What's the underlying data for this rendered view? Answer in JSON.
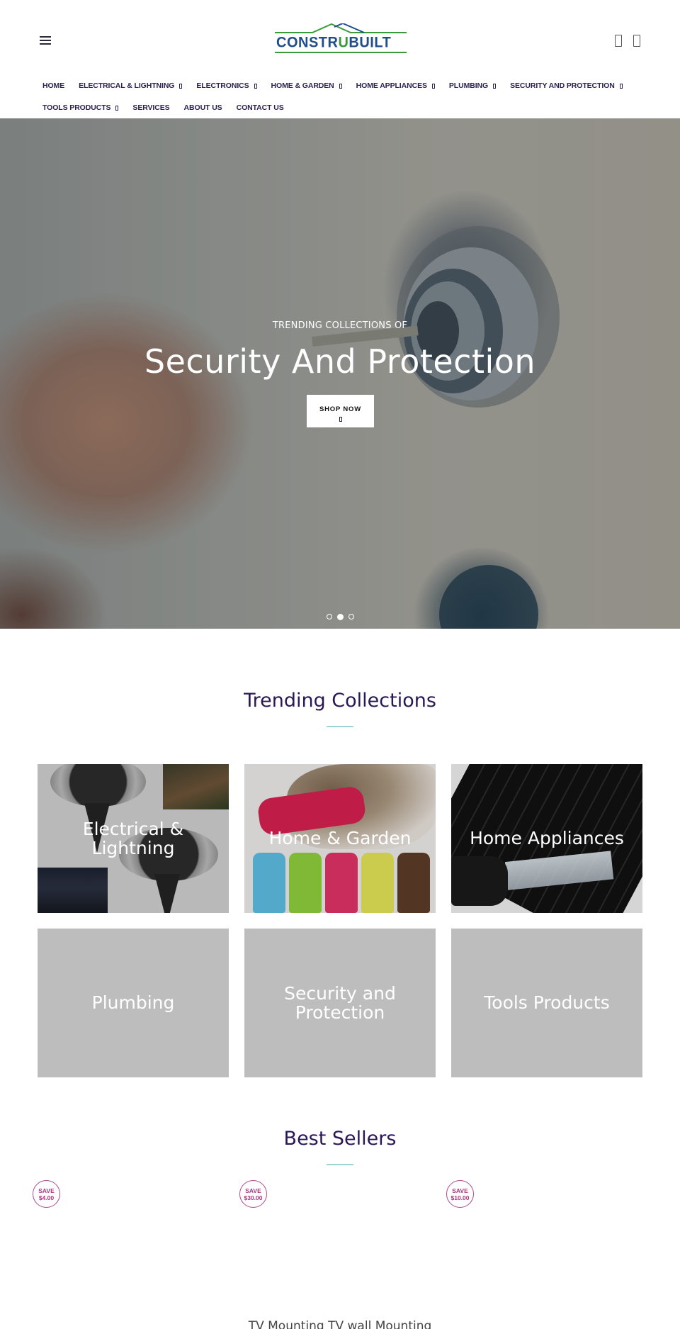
{
  "header": {
    "logo_text_left": "CONSTR",
    "logo_text_u": "U",
    "logo_text_right": "BUILT",
    "logo_colors": {
      "blue": "#1f4e8c",
      "green": "#3a9a3a"
    },
    "icons": [
      "menu-icon",
      "account-icon",
      "cart-icon"
    ]
  },
  "nav": {
    "row1": [
      {
        "label": "HOME",
        "has_dropdown": false
      },
      {
        "label": "ELECTRICAL & LIGHTNING",
        "has_dropdown": true
      },
      {
        "label": "ELECTRONICS",
        "has_dropdown": true
      },
      {
        "label": "HOME & GARDEN",
        "has_dropdown": true
      },
      {
        "label": "HOME APPLIANCES",
        "has_dropdown": true
      },
      {
        "label": "PLUMBING",
        "has_dropdown": true
      },
      {
        "label": "SECURITY AND PROTECTION",
        "has_dropdown": true
      }
    ],
    "row2": [
      {
        "label": "TOOLS PRODUCTS",
        "has_dropdown": true
      },
      {
        "label": "SERVICES",
        "has_dropdown": false
      },
      {
        "label": "ABOUT US",
        "has_dropdown": false
      },
      {
        "label": "CONTACT US",
        "has_dropdown": false
      }
    ]
  },
  "hero": {
    "subtitle": "TRENDING COLLECTIONS OF",
    "title": "Security And Protection",
    "button_label": "SHOP NOW",
    "slides_total": 3,
    "active_slide": 2
  },
  "trending": {
    "title": "Trending Collections",
    "collections": [
      {
        "label": "Electrical & Lightning"
      },
      {
        "label": "Home & Garden"
      },
      {
        "label": "Home Appliances"
      },
      {
        "label": "Plumbing"
      },
      {
        "label": "Security and Protection"
      },
      {
        "label": "Tools Products"
      }
    ]
  },
  "best_sellers": {
    "title": "Best Sellers",
    "badges": [
      {
        "line1": "SAVE",
        "line2": "$4.00"
      },
      {
        "line1": "SAVE",
        "line2": "$30.00"
      },
      {
        "line1": "SAVE",
        "line2": "$10.00"
      }
    ],
    "first_product_name": "TV Mounting TV wall Mounting"
  },
  "colors": {
    "heading": "#2a1856",
    "accent_rule": "#9fd3d3",
    "badge": "#a8357f",
    "placeholder_tile": "#bdbdbd"
  }
}
